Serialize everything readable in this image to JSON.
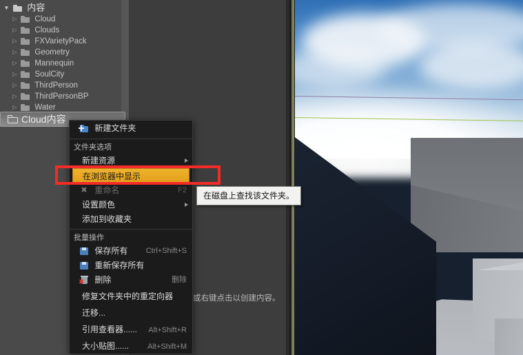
{
  "app": {
    "accent_highlight": "#e2a01b",
    "annotation_color": "#f32c28",
    "menu_bg": "#1b1b1b",
    "panel_bg": "#4a4a4a"
  },
  "tree": {
    "root": {
      "label": "内容",
      "icon": "folder-icon",
      "twisty": "expanded"
    },
    "items": [
      {
        "label": "Cloud",
        "icon": "folder-icon",
        "twisty": "collapsed"
      },
      {
        "label": "Clouds",
        "icon": "folder-icon",
        "twisty": "collapsed"
      },
      {
        "label": "FXVarietyPack",
        "icon": "folder-icon",
        "twisty": "collapsed"
      },
      {
        "label": "Geometry",
        "icon": "folder-icon",
        "twisty": "collapsed"
      },
      {
        "label": "Mannequin",
        "icon": "folder-icon",
        "twisty": "collapsed"
      },
      {
        "label": "SoulCity",
        "icon": "folder-icon",
        "twisty": "collapsed"
      },
      {
        "label": "ThirdPerson",
        "icon": "folder-icon",
        "twisty": "collapsed"
      },
      {
        "label": "ThirdPersonBP",
        "icon": "folder-icon",
        "twisty": "collapsed"
      },
      {
        "label": "Water",
        "icon": "folder-icon",
        "twisty": "collapsed"
      }
    ],
    "drag_chip": {
      "label": "Cloud内容",
      "icon": "folder-outline-icon"
    }
  },
  "content_browser": {
    "empty_hint": "或右键点击以创建内容。"
  },
  "context_menu": {
    "new_folder": {
      "label": "新建文件夹",
      "icon": "new-folder-icon",
      "shortcut": ""
    },
    "section_folder_options": "文件夹选项",
    "new_asset": {
      "label": "新建资源",
      "shortcut": "",
      "submenu": true
    },
    "show_in_explorer": {
      "label": "在浏览器中显示",
      "shortcut": "",
      "submenu": false
    },
    "rename": {
      "label": "重命名",
      "shortcut": "F2",
      "icon": "rename-icon",
      "disabled": true
    },
    "set_color": {
      "label": "设置颜色",
      "shortcut": "",
      "submenu": true
    },
    "add_to_favorites": {
      "label": "添加到收藏夹",
      "shortcut": ""
    },
    "section_bulk_operations": "批量操作",
    "save_all": {
      "label": "保存所有",
      "shortcut": "Ctrl+Shift+S",
      "icon": "save-icon"
    },
    "resave_all": {
      "label": "重新保存所有",
      "shortcut": "",
      "icon": "save-icon"
    },
    "delete": {
      "label": "删除",
      "shortcut": "删除",
      "icon": "delete-icon"
    },
    "fix_redirectors": {
      "label": "修复文件夹中的重定向器",
      "shortcut": ""
    },
    "migrate": {
      "label": "迁移...",
      "shortcut": ""
    },
    "reference_viewer": {
      "label": "引用查看器......",
      "shortcut": "Alt+Shift+R"
    },
    "size_map": {
      "label": "大小贴图......",
      "shortcut": "Alt+Shift+M"
    }
  },
  "tooltip": {
    "text": "在磁盘上查找该文件夹。"
  }
}
